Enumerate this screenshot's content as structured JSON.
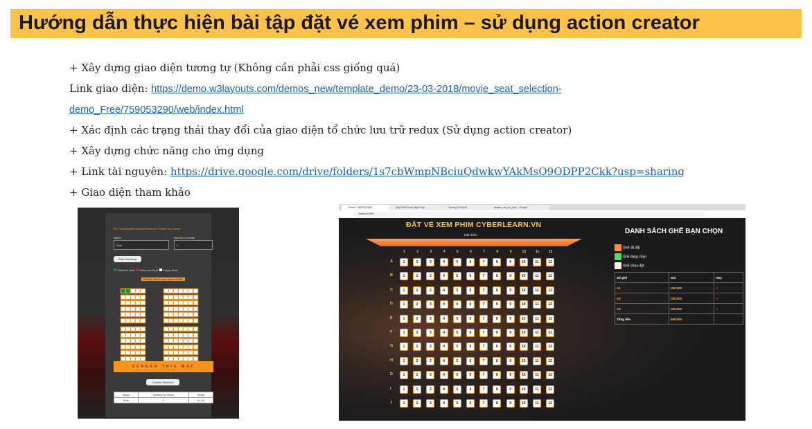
{
  "title": "Hướng dẫn thực hiện bài tập đặt vé xem phim – sử dụng action creator",
  "lines": {
    "l1": "+ Xây dựng giao diện tương tự (Không cần phải css giống quá)",
    "l2_label": " Link giao diện: ",
    "l2_link_a": "https://demo.w3layouts.com/demos_new/template_demo/23-03-2018/movie_seat_selection-",
    "l2_link_b": "demo_Free/759053290/web/index.html",
    "l3": "+ Xác định các trạng thái thay đổi của giao diện tổ chức lưu trữ redux (Sử dụng action creator)",
    "l4": "+ Xây dựng chức năng cho ứng dụng",
    "l5_label": "+ Link tài nguyên: ",
    "l5_link": "https://drive.google.com/drive/folders/1s7cbWmpNBciuQdwkwYAkMsO9ODPP2Ckk?usp=sharing",
    "l6": "+ Giao diện tham khảo"
  },
  "shotA": {
    "heading": "Fill The Required Details Below And Select Your Seats",
    "name_label": "Name",
    "seats_label": "Number of Seats",
    "name_value": "Khải",
    "seats_value": "2",
    "start_btn": "Start Selecting",
    "legend_selected": "Selected Seat",
    "legend_reserved": "Reserved Seat",
    "legend_empty": "Empty Seat",
    "select_banner": "Please Select your Seats NOW!",
    "screen": "SCREEN THIS WAY",
    "confirm_btn": "Confirm Selection",
    "table_head": [
      "Name",
      "Number of Seats",
      "Seats"
    ],
    "table_row": [
      "Khải",
      "2",
      "A1,A2"
    ]
  },
  "shotB": {
    "tabs": [
      "React CYBERLEARN",
      "(28) FAPA Conn Nguoi Tap",
      "Trường Tân Khải",
      "cinema_dat_ve_phim - Google"
    ],
    "url": "localhost:3000",
    "heading": "ĐẶT VÉ XEM PHIM CYBERLEARN.VN",
    "screen_label": "Màn hình",
    "rows": [
      "A",
      "B",
      "C",
      "D",
      "E",
      "F",
      "G",
      "H",
      "D",
      "I",
      "J"
    ],
    "cols": [
      "1",
      "2",
      "3",
      "4",
      "5",
      "6",
      "7",
      "8",
      "9",
      "10",
      "11",
      "12"
    ],
    "side_title": "DANH SÁCH GHẾ BẠN CHỌN",
    "legend": [
      "Ghế đã đặt",
      "Ghế đang chọn",
      "Ghế chưa đặt"
    ],
    "legend_colors": [
      "#f7941d",
      "#4cd964",
      "#fff3e0"
    ],
    "table_head": [
      "Số ghế",
      "Giá",
      "Hủy"
    ],
    "table_rows": [
      [
        "A1",
        "150.000",
        "X"
      ],
      [
        "A2",
        "150.000",
        "X"
      ],
      [
        "A3",
        "150.000",
        "X"
      ]
    ],
    "total_label": "Tổng tiền",
    "total_value": "450.000"
  }
}
